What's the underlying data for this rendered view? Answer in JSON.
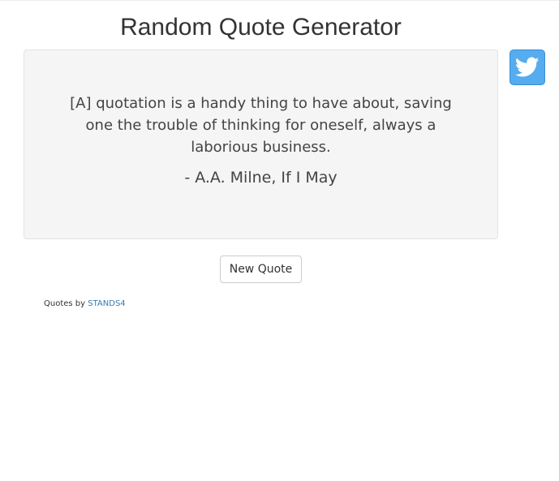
{
  "header": {
    "title": "Random Quote Generator"
  },
  "quote": {
    "text": "[A] quotation is a handy thing to have about, saving one the trouble of thinking for oneself, always a laborious business.",
    "author": "- A.A. Milne, If I May"
  },
  "actions": {
    "tweet_icon": "twitter-icon",
    "tweet_color": "#55acee",
    "new_quote_label": "New Quote"
  },
  "footer": {
    "credit_prefix": "Quotes by",
    "credit_link": "STANDS4",
    "link_color": "#337ab7"
  }
}
